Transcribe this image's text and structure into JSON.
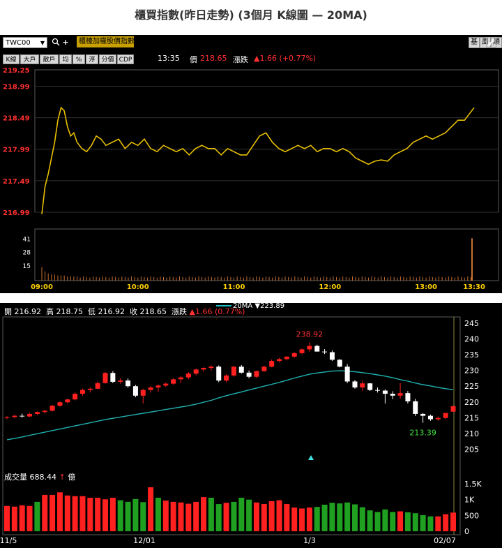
{
  "page_title": "櫃買指數(昨日走勢) (3個月 K線圖  — 20MA)",
  "toolbar": {
    "symbol": "TWC00",
    "symbol_caret": "▼",
    "search_icon": "magnifier-icon",
    "add_icon": "plus-icon",
    "index_name": "櫃檯加權股價指數",
    "buttons": [
      "K線",
      "大戶",
      "散戶",
      "均",
      "%",
      "浮",
      "分價",
      "CDP"
    ],
    "right_buttons": [
      "基",
      "風",
      "順"
    ],
    "time": "13:35",
    "price_label": "價",
    "price": "218.65",
    "change_label": "漲跌",
    "change": "▲1.66 (+0.77%)"
  },
  "colors": {
    "intraday_line": "#e8c000",
    "volume_bar": "#c87030",
    "up": "#ff2020",
    "down": "#ffffff",
    "ma": "#20b0b0",
    "grid": "#5a5a5a",
    "axis_red": "#ff3030"
  },
  "kline": {
    "ohlc_text": {
      "open_label": "開",
      "open": "216.92",
      "high_label": "高",
      "high": "218.75",
      "low_label": "低",
      "low": "216.92",
      "close_label": "收",
      "close": "218.65",
      "change_label": "漲跌",
      "change": "▲1.66 (0.77%)"
    },
    "ma_legend": {
      "label": "20MA",
      "marker": "▼",
      "value": "223.89"
    },
    "high_annotation": "238.92",
    "low_annotation": "213.39",
    "volume_label": {
      "label": "成交量",
      "value": "688.44",
      "arrow": "↑",
      "unit": "億"
    }
  },
  "chart_data": [
    {
      "type": "line",
      "title": "",
      "x_ticks": [
        "09:00",
        "10:00",
        "11:00",
        "12:00",
        "13:00",
        "13:30"
      ],
      "y_ticks": [
        "219.25",
        "218.99",
        "218.49",
        "217.99",
        "217.49",
        "216.99"
      ],
      "ylim": [
        216.99,
        219.25
      ],
      "series": [
        {
          "x": [
            "09:00",
            "09:02",
            "09:04",
            "09:06",
            "09:08",
            "09:10",
            "09:12",
            "09:14",
            "09:16",
            "09:18",
            "09:20",
            "09:22",
            "09:25",
            "09:28",
            "09:31",
            "09:34",
            "09:37",
            "09:40",
            "09:44",
            "09:48",
            "09:52",
            "09:56",
            "10:00",
            "10:04",
            "10:08",
            "10:12",
            "10:16",
            "10:20",
            "10:24",
            "10:28",
            "10:32",
            "10:36",
            "10:40",
            "10:44",
            "10:48",
            "10:52",
            "10:56",
            "11:00",
            "11:04",
            "11:08",
            "11:12",
            "11:16",
            "11:20",
            "11:24",
            "11:28",
            "11:32",
            "11:36",
            "11:40",
            "11:44",
            "11:48",
            "11:52",
            "11:56",
            "12:00",
            "12:04",
            "12:08",
            "12:12",
            "12:16",
            "12:20",
            "12:24",
            "12:28",
            "12:32",
            "12:36",
            "12:40",
            "12:44",
            "12:48",
            "12:52",
            "12:56",
            "13:00",
            "13:04",
            "13:08",
            "13:12",
            "13:16",
            "13:20",
            "13:24",
            "13:27",
            "13:30"
          ],
          "values": [
            216.96,
            217.4,
            217.6,
            217.85,
            218.1,
            218.45,
            218.65,
            218.6,
            218.35,
            218.2,
            218.25,
            218.1,
            218.0,
            217.95,
            218.05,
            218.2,
            218.15,
            218.05,
            218.1,
            218.15,
            218.0,
            218.1,
            218.05,
            218.15,
            218.0,
            217.95,
            218.05,
            218.0,
            217.95,
            218.0,
            217.9,
            218.0,
            218.05,
            218.0,
            218.0,
            217.9,
            218.0,
            217.95,
            217.9,
            217.9,
            218.05,
            218.2,
            218.25,
            218.1,
            218.0,
            217.95,
            218.0,
            218.05,
            218.0,
            218.05,
            217.95,
            218.0,
            218.0,
            217.95,
            218.0,
            217.95,
            217.85,
            217.8,
            217.75,
            217.8,
            217.82,
            217.8,
            217.9,
            217.95,
            218.0,
            218.1,
            218.15,
            218.2,
            218.15,
            218.2,
            218.25,
            218.35,
            218.45,
            218.45,
            218.55,
            218.65
          ]
        }
      ]
    },
    {
      "type": "bar",
      "title": "",
      "y_ticks": [
        "41",
        "28",
        "15"
      ],
      "ylim": [
        0,
        50
      ],
      "values_first_minutes": [
        13,
        9,
        7,
        6,
        6,
        5,
        5,
        5,
        4,
        4,
        4,
        4
      ],
      "values_typical": 3,
      "values_last": 41
    },
    {
      "type": "candlestick",
      "title": "",
      "x_ticks": [
        "11/5",
        "12/01",
        "1/3",
        "02/07"
      ],
      "y_ticks": [
        "245",
        "240",
        "235",
        "230",
        "225",
        "220",
        "215",
        "210",
        "205"
      ],
      "ylim": [
        200,
        247
      ],
      "ohlc": [
        [
          215.0,
          215.5,
          214.5,
          215.2
        ],
        [
          215.2,
          216.0,
          214.8,
          215.6
        ],
        [
          215.6,
          216.3,
          215.0,
          215.4
        ],
        [
          215.4,
          216.5,
          215.2,
          216.2
        ],
        [
          216.2,
          217.0,
          215.8,
          216.8
        ],
        [
          216.8,
          217.5,
          216.3,
          217.2
        ],
        [
          217.2,
          219.0,
          217.0,
          218.8
        ],
        [
          218.8,
          220.2,
          218.5,
          219.9
        ],
        [
          219.9,
          221.0,
          219.5,
          220.8
        ],
        [
          220.8,
          223.0,
          220.5,
          222.6
        ],
        [
          222.6,
          224.2,
          222.0,
          223.8
        ],
        [
          223.8,
          224.6,
          223.0,
          224.2
        ],
        [
          224.2,
          226.5,
          224.0,
          226.0
        ],
        [
          226.0,
          229.5,
          225.8,
          229.2
        ],
        [
          229.2,
          229.8,
          226.0,
          226.4
        ],
        [
          226.4,
          227.5,
          225.8,
          226.8
        ],
        [
          226.8,
          227.5,
          224.5,
          225.0
        ],
        [
          225.0,
          225.4,
          221.5,
          222.0
        ],
        [
          222.0,
          224.2,
          219.5,
          223.8
        ],
        [
          223.8,
          225.0,
          223.0,
          224.6
        ],
        [
          224.6,
          225.5,
          223.2,
          225.2
        ],
        [
          225.2,
          226.2,
          224.8,
          225.8
        ],
        [
          225.8,
          227.5,
          225.5,
          227.2
        ],
        [
          227.2,
          228.2,
          226.0,
          227.8
        ],
        [
          227.8,
          229.5,
          227.2,
          229.0
        ],
        [
          229.0,
          230.6,
          228.5,
          230.3
        ],
        [
          230.3,
          231.0,
          229.6,
          230.8
        ],
        [
          230.8,
          231.6,
          230.0,
          231.2
        ],
        [
          231.2,
          231.6,
          226.3,
          226.8
        ],
        [
          226.8,
          228.8,
          226.2,
          228.4
        ],
        [
          228.4,
          231.5,
          228.0,
          231.2
        ],
        [
          231.2,
          231.7,
          229.0,
          229.3
        ],
        [
          229.3,
          230.0,
          227.5,
          228.0
        ],
        [
          228.0,
          230.0,
          227.5,
          229.8
        ],
        [
          229.8,
          231.5,
          229.5,
          231.2
        ],
        [
          231.2,
          233.5,
          231.0,
          233.0
        ],
        [
          233.0,
          234.0,
          232.6,
          233.6
        ],
        [
          233.6,
          234.5,
          233.2,
          234.4
        ],
        [
          234.4,
          235.8,
          234.0,
          235.5
        ],
        [
          235.5,
          237.0,
          235.2,
          236.7
        ],
        [
          236.7,
          238.92,
          236.0,
          237.8
        ],
        [
          237.8,
          238.2,
          236.5,
          236.0
        ],
        [
          236.0,
          236.8,
          235.2,
          235.8
        ],
        [
          235.8,
          236.4,
          233.0,
          233.4
        ],
        [
          233.4,
          233.6,
          231.0,
          231.2
        ],
        [
          231.2,
          232.0,
          226.0,
          226.5
        ],
        [
          226.5,
          227.0,
          224.2,
          224.6
        ],
        [
          224.6,
          226.8,
          223.5,
          225.9
        ],
        [
          225.9,
          226.0,
          223.5,
          223.8
        ],
        [
          223.8,
          224.6,
          223.0,
          223.6
        ],
        [
          223.6,
          224.0,
          219.5,
          222.6
        ],
        [
          222.6,
          223.4,
          220.9,
          222.0
        ],
        [
          222.0,
          226.0,
          221.0,
          222.8
        ],
        [
          222.8,
          223.5,
          219.5,
          220.2
        ],
        [
          220.2,
          221.0,
          215.5,
          216.2
        ],
        [
          216.2,
          216.5,
          213.39,
          215.6
        ],
        [
          215.6,
          216.0,
          214.0,
          214.5
        ],
        [
          214.5,
          215.4,
          214.0,
          214.9
        ],
        [
          214.9,
          216.5,
          214.6,
          216.5
        ],
        [
          216.92,
          218.75,
          216.92,
          218.65
        ]
      ],
      "ma20": [
        208,
        208.4,
        208.9,
        209.4,
        209.9,
        210.4,
        210.9,
        211.4,
        211.9,
        212.4,
        212.9,
        213.4,
        213.9,
        214.4,
        214.8,
        215.2,
        215.6,
        216.0,
        216.4,
        216.8,
        217.2,
        217.6,
        218.0,
        218.4,
        218.8,
        219.3,
        219.9,
        220.5,
        221.3,
        222.0,
        222.6,
        223.2,
        223.8,
        224.4,
        225.0,
        225.6,
        226.2,
        226.9,
        227.6,
        228.2,
        228.8,
        229.2,
        229.5,
        229.8,
        229.9,
        229.8,
        229.6,
        229.3,
        229.0,
        228.6,
        228.2,
        227.7,
        227.1,
        226.6,
        226.0,
        225.5,
        225.1,
        224.6,
        224.2,
        223.89
      ]
    },
    {
      "type": "bar",
      "title": "",
      "y_ticks": [
        "1.5K",
        "1K",
        "500",
        "0"
      ],
      "ylim": [
        0,
        1700
      ],
      "values": [
        800,
        780,
        820,
        800,
        930,
        1150,
        1150,
        1230,
        1130,
        1110,
        1110,
        1060,
        1060,
        1010,
        1060,
        980,
        930,
        1020,
        920,
        1390,
        1060,
        970,
        930,
        910,
        870,
        930,
        1080,
        1060,
        860,
        900,
        930,
        1060,
        1000,
        910,
        860,
        950,
        980,
        860,
        750,
        720,
        750,
        770,
        840,
        900,
        880,
        910,
        850,
        760,
        660,
        610,
        690,
        610,
        630,
        600,
        570,
        510,
        470,
        470,
        540,
        590
      ],
      "up_flags": [
        1,
        1,
        1,
        1,
        0,
        1,
        1,
        1,
        1,
        1,
        1,
        1,
        1,
        1,
        1,
        0,
        0,
        0,
        0,
        1,
        0,
        1,
        1,
        1,
        1,
        1,
        1,
        0,
        0,
        1,
        0,
        0,
        0,
        1,
        1,
        1,
        1,
        1,
        1,
        1,
        1,
        0,
        0,
        0,
        0,
        0,
        0,
        0,
        0,
        0,
        0,
        0,
        1,
        0,
        0,
        0,
        0,
        1,
        1,
        1
      ]
    }
  ]
}
